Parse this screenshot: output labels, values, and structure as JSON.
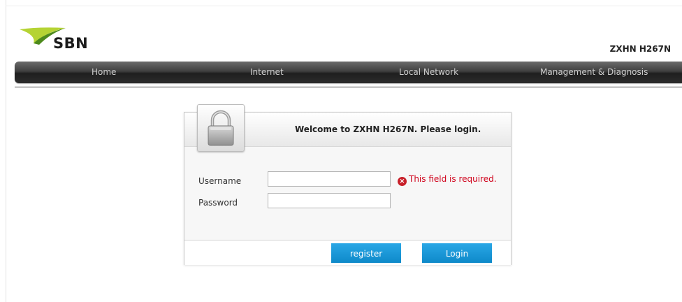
{
  "brand": {
    "logo_text": "SBN",
    "model": "ZXHN H267N",
    "colors": {
      "swoosh_light": "#b5d334",
      "swoosh_dark": "#4d8a1c"
    }
  },
  "nav": {
    "items": [
      {
        "label": "Home"
      },
      {
        "label": "Internet"
      },
      {
        "label": "Local Network"
      },
      {
        "label": "Management & Diagnosis"
      }
    ]
  },
  "login": {
    "icon": "lock-icon",
    "welcome": "Welcome to ZXHN H267N. Please login.",
    "username_label": "Username",
    "username_value": "",
    "password_label": "Password",
    "password_value": "",
    "username_error": "This field is required.",
    "error_icon": "error-x-icon",
    "error_color": "#d0021b",
    "register_label": "register",
    "login_label": "Login",
    "button_color": "#1a9bd8"
  }
}
